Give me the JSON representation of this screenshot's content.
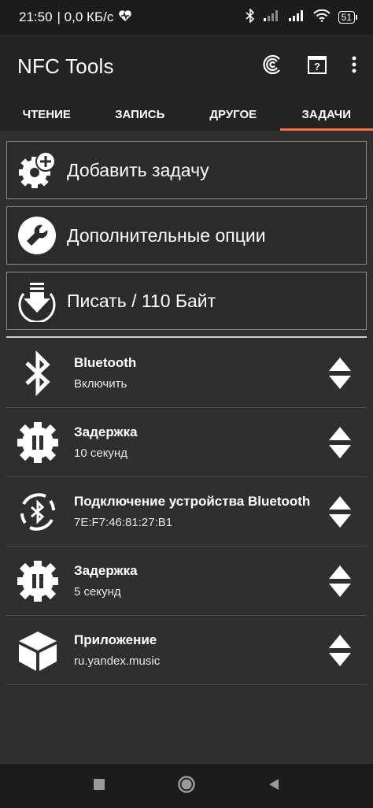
{
  "status": {
    "time": "21:50",
    "speed": "| 0,0 КБ/с",
    "battery": "51"
  },
  "app": {
    "title": "NFC Tools"
  },
  "tabs": [
    {
      "label": "ЧТЕНИЕ"
    },
    {
      "label": "ЗАПИСЬ"
    },
    {
      "label": "ДРУГОЕ"
    },
    {
      "label": "ЗАДАЧИ"
    }
  ],
  "actions": {
    "add_task": "Добавить задачу",
    "more_options": "Дополнительные опции",
    "write": "Писать / 110 Байт"
  },
  "tasks": [
    {
      "title": "Bluetooth",
      "value": "Включить",
      "icon": "bluetooth-icon"
    },
    {
      "title": "Задержка",
      "value": "10 секунд",
      "icon": "pause-gear-icon"
    },
    {
      "title": "Подключение устройства Bluetooth",
      "value": "7E:F7:46:81:27:B1",
      "icon": "bluetooth-connect-icon"
    },
    {
      "title": "Задержка",
      "value": "5 секунд",
      "icon": "pause-gear-icon"
    },
    {
      "title": "Приложение",
      "value": "ru.yandex.music",
      "icon": "app-box-icon"
    }
  ],
  "colors": {
    "accent": "#ff6a3d",
    "background": "#2f2f2f",
    "bar": "#232323"
  }
}
